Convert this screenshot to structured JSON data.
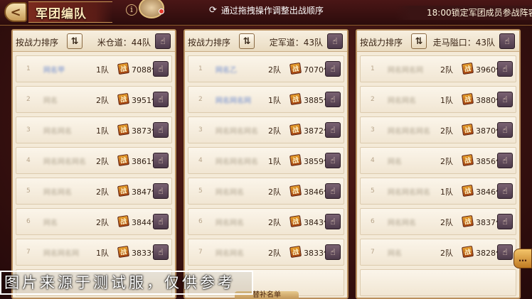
{
  "header": {
    "back_label": "<",
    "title": "军团编队",
    "info_label": "i",
    "hint": "通过拖拽操作调整出战顺序",
    "marquee": "18:00锁定军团成员参战阵容"
  },
  "icons": {
    "refresh": "⟳",
    "sort": "⇅",
    "hand": "☝",
    "power_badge": "战",
    "chat": "…"
  },
  "colors": {
    "panel_bg": "#f4ead8",
    "hand_button": "#5d4658",
    "power_badge": "#c5671a",
    "title_plate": "#6a241a"
  },
  "panels": [
    {
      "sort_label": "按战力排序",
      "route": "米仓道：44队",
      "rows": [
        {
          "rank": "1",
          "name": "网名甲",
          "team": "1队",
          "power": "7088亿",
          "highlight": true
        },
        {
          "rank": "2",
          "name": "网名",
          "team": "2队",
          "power": "3951亿",
          "highlight": false
        },
        {
          "rank": "3",
          "name": "网名网名",
          "team": "1队",
          "power": "3873亿",
          "highlight": false
        },
        {
          "rank": "4",
          "name": "网名网名网名",
          "team": "2队",
          "power": "3861亿",
          "highlight": false
        },
        {
          "rank": "5",
          "name": "网名网名",
          "team": "2队",
          "power": "3847亿",
          "highlight": false
        },
        {
          "rank": "6",
          "name": "网名",
          "team": "2队",
          "power": "3844亿",
          "highlight": false
        },
        {
          "rank": "7",
          "name": "网名网名网",
          "team": "1队",
          "power": "3833亿",
          "highlight": false
        }
      ]
    },
    {
      "sort_label": "按战力排序",
      "route": "定军道：43队",
      "rows": [
        {
          "rank": "1",
          "name": "网名乙",
          "team": "2队",
          "power": "7070亿",
          "highlight": true
        },
        {
          "rank": "2",
          "name": "网名网名网",
          "team": "1队",
          "power": "3885亿",
          "highlight": true
        },
        {
          "rank": "3",
          "name": "网名网名网名",
          "team": "2队",
          "power": "3872亿",
          "highlight": false
        },
        {
          "rank": "4",
          "name": "网名网名网名",
          "team": "1队",
          "power": "3859亿",
          "highlight": false
        },
        {
          "rank": "5",
          "name": "网名网名",
          "team": "2队",
          "power": "3846亿",
          "highlight": false
        },
        {
          "rank": "6",
          "name": "网名网名",
          "team": "2队",
          "power": "3843亿",
          "highlight": false
        },
        {
          "rank": "7",
          "name": "网名网名",
          "team": "2队",
          "power": "3833亿",
          "highlight": false
        }
      ]
    },
    {
      "sort_label": "按战力排序",
      "route": "走马隘口：43队",
      "rows": [
        {
          "rank": "1",
          "name": "网名网名网",
          "team": "2队",
          "power": "3960亿",
          "highlight": false
        },
        {
          "rank": "2",
          "name": "网名网名",
          "team": "1队",
          "power": "3880亿",
          "highlight": false
        },
        {
          "rank": "3",
          "name": "网名网名网名",
          "team": "2队",
          "power": "3870亿",
          "highlight": false
        },
        {
          "rank": "4",
          "name": "网名",
          "team": "2队",
          "power": "3856亿",
          "highlight": false
        },
        {
          "rank": "5",
          "name": "网名网名网名",
          "team": "1队",
          "power": "3846亿",
          "highlight": false
        },
        {
          "rank": "6",
          "name": "网名网名",
          "team": "2队",
          "power": "3837亿",
          "highlight": false
        },
        {
          "rank": "7",
          "name": "网名",
          "team": "2队",
          "power": "3828亿",
          "highlight": false
        }
      ]
    }
  ],
  "footer": {
    "watermark": "图片来源于测试服，仅供参考",
    "bottom_tab": "替补名单"
  }
}
